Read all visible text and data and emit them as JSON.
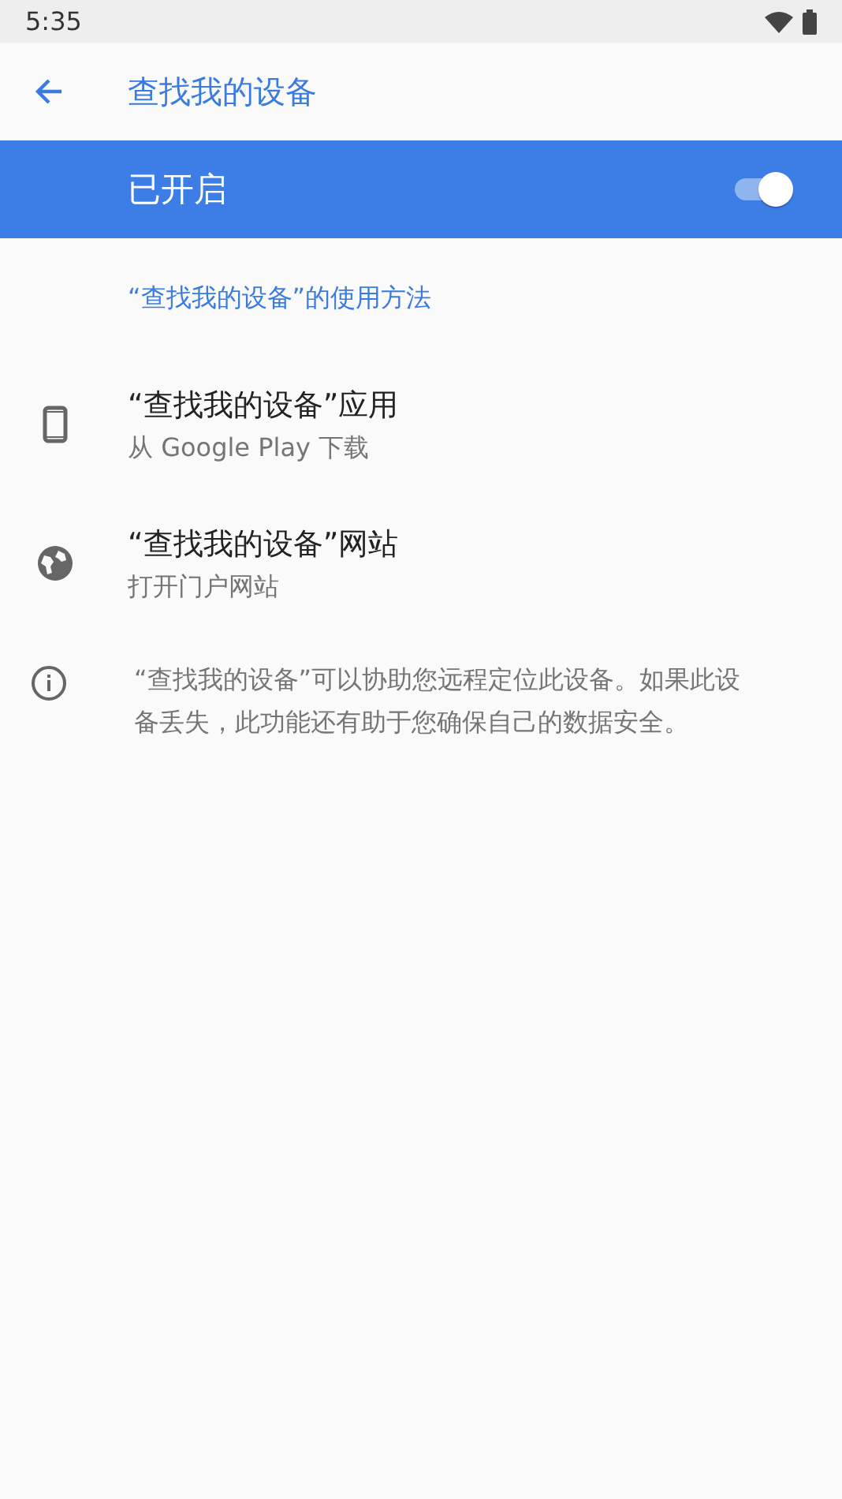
{
  "status_bar": {
    "time": "5:35"
  },
  "toolbar": {
    "title": "查找我的设备"
  },
  "master_switch": {
    "label": "已开启",
    "on": true
  },
  "section_header": "“查找我的设备”的使用方法",
  "items": [
    {
      "kind": "phone",
      "title": "“查找我的设备”应用",
      "subtitle": "从 Google Play 下载"
    },
    {
      "kind": "globe",
      "title": "“查找我的设备”网站",
      "subtitle": "打开门户网站"
    }
  ],
  "info": "“查找我的设备”可以协助您远程定位此设备。如果此设备丢失，此功能还有助于您确保自己的数据安全。"
}
